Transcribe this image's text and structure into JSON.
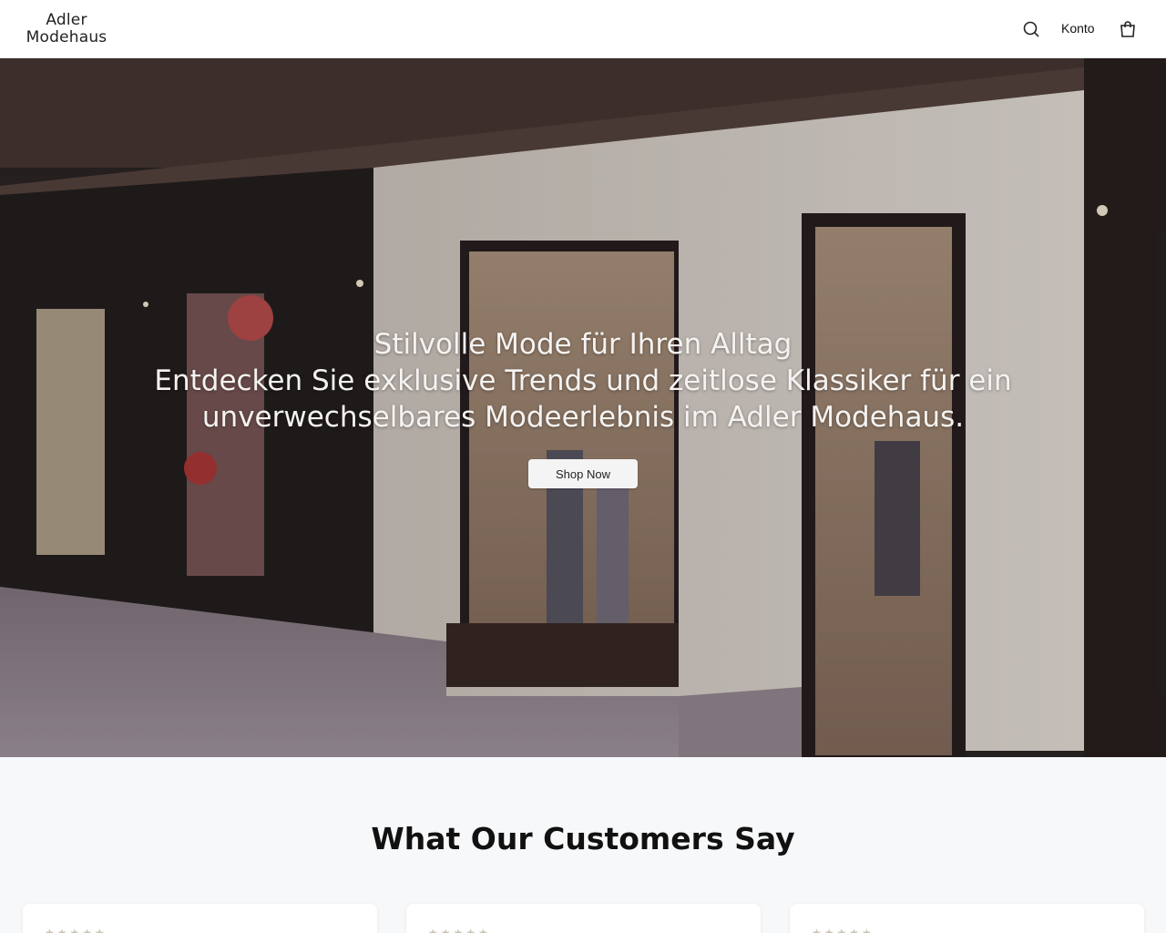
{
  "header": {
    "logo_line1": "Adler",
    "logo_line2": "Modehaus",
    "account_label": "Konto",
    "icons": {
      "search": "search-icon",
      "cart": "shopping-bag-icon"
    }
  },
  "hero": {
    "headline": "Stilvolle Mode für Ihren Alltag",
    "subheadline": "Entdecken Sie exklusive Trends und zeitlose Klassiker für ein unverwechselbares Modeerlebnis im Adler Modehaus.",
    "cta_label": "Shop Now"
  },
  "testimonials": {
    "title": "What Our Customers Say",
    "cards": [
      {
        "stars": "★★★★★"
      },
      {
        "stars": "★★★★★"
      },
      {
        "stars": "★★★★★"
      }
    ]
  },
  "colors": {
    "header_bg": "#ffffff",
    "section_bg": "#f7f8fa",
    "button_bg": "#f4f4f4",
    "text": "#111111"
  }
}
